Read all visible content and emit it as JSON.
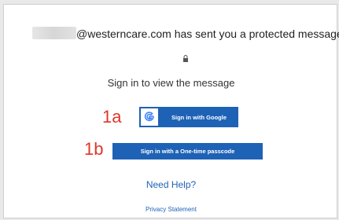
{
  "header": {
    "sender_domain_text": "@westerncare.com has sent you a protected message"
  },
  "icons": {
    "lock": "lock-icon",
    "google": "google-g-icon"
  },
  "main": {
    "subtitle": "Sign in to view the message",
    "google_button_label": "Sign in with Google",
    "otp_button_label": "Sign in with a One-time passcode",
    "need_help": "Need Help?",
    "privacy": "Privacy Statement"
  },
  "annotations": {
    "a": "1a",
    "b": "1b"
  },
  "colors": {
    "button_blue": "#1e62b6",
    "annotation_red": "#e0362a"
  }
}
